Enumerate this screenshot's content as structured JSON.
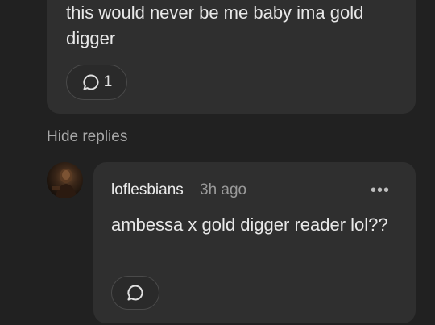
{
  "parent_comment": {
    "text": "this would never be me baby ima gold digger",
    "reply_count": "1",
    "reply_icon": "comment-bubble-icon"
  },
  "hide_replies_label": "Hide replies",
  "reply": {
    "username": "loflesbians",
    "timestamp": "3h ago",
    "more_label": "•••",
    "text": "ambessa x gold digger reader lol??",
    "reply_icon": "comment-bubble-icon"
  },
  "colors": {
    "background": "#212121",
    "card": "#2f2f2f",
    "text_primary": "#e8e8e8",
    "text_muted": "#9a9a9a"
  }
}
